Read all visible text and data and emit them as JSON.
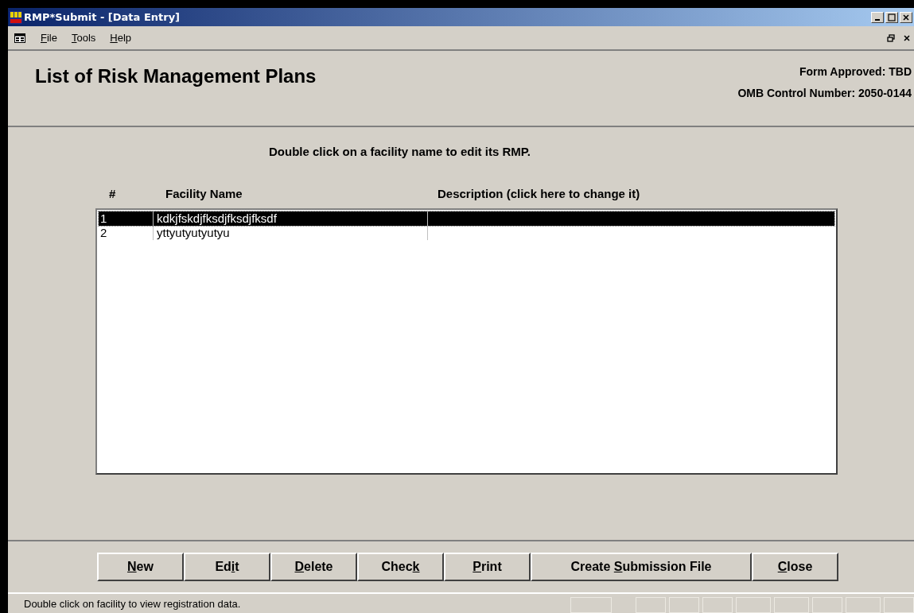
{
  "window": {
    "title": "RMP*Submit - [Data Entry]"
  },
  "menu": [
    {
      "label": "File"
    },
    {
      "label": "Tools"
    },
    {
      "label": "Help"
    }
  ],
  "header": {
    "title": "List of Risk Management Plans",
    "form_approved": "Form Approved:  TBD",
    "omb": "OMB Control Number:  2050-0144"
  },
  "instruction": "Double click on a facility name to edit its RMP.",
  "table": {
    "columns": [
      "#",
      "Facility Name",
      "Description (click here to change it)"
    ],
    "rows": [
      {
        "number": "1",
        "facility": "kdkjfskdjfksdjfksdjfksdf",
        "selected": true
      },
      {
        "number": "2",
        "facility": "yttyutyutyutyu",
        "selected": false
      }
    ]
  },
  "buttons": [
    {
      "label": "New"
    },
    {
      "label": "Edit"
    },
    {
      "label": "Delete"
    },
    {
      "label": "Check"
    },
    {
      "label": "Print"
    },
    {
      "label": "Create Submission File"
    },
    {
      "label": "Close"
    }
  ],
  "status_bar": "Double click on facility to view registration data."
}
